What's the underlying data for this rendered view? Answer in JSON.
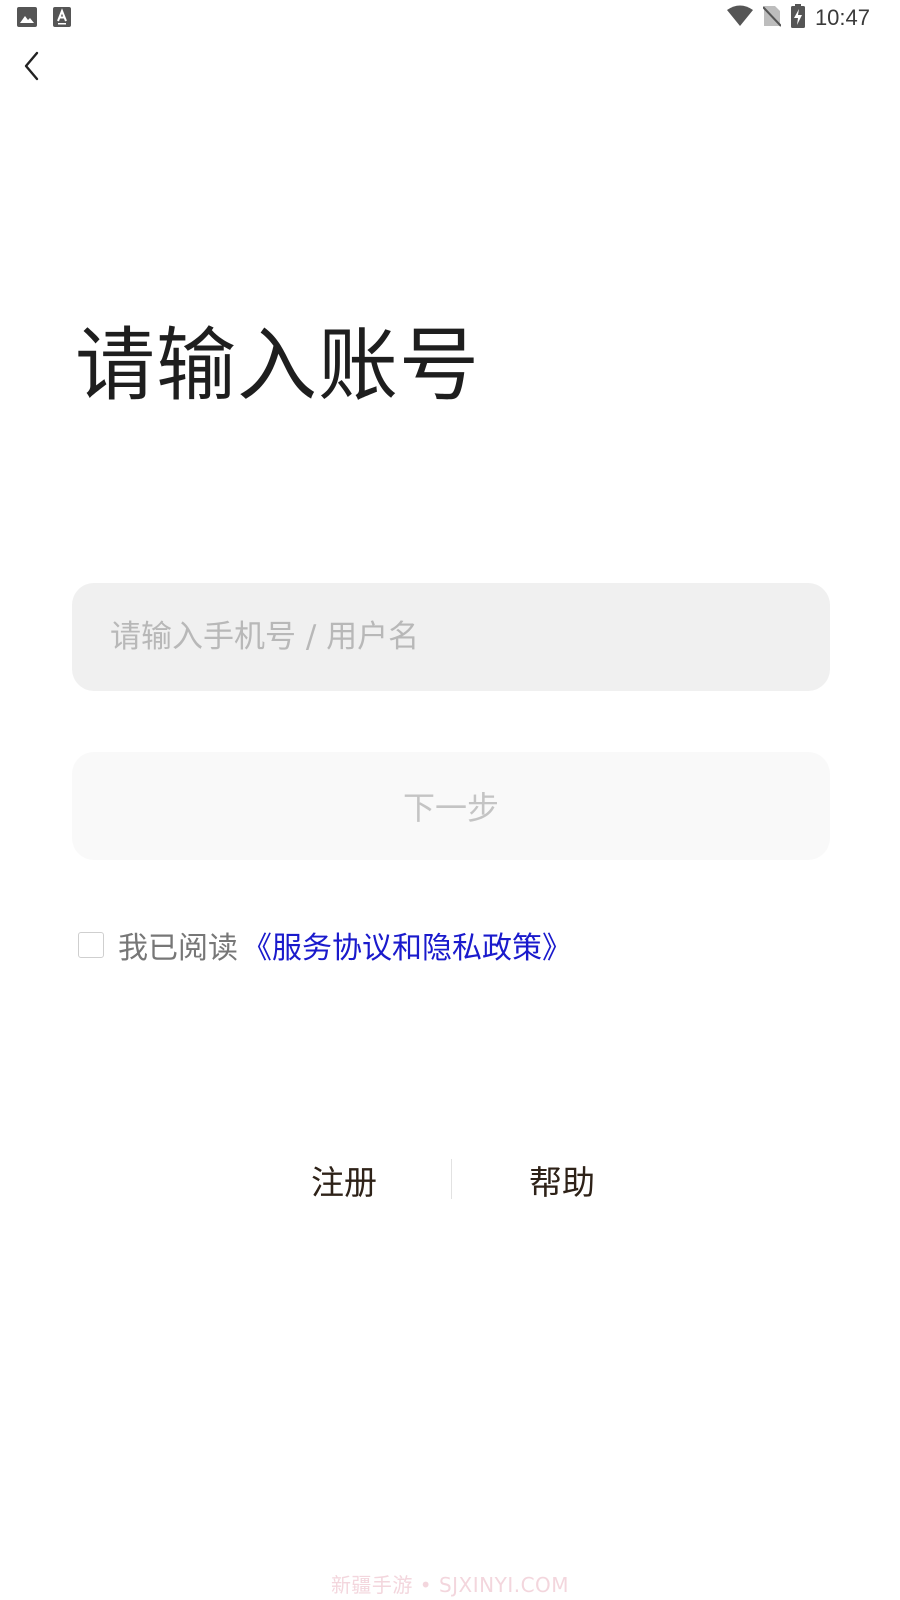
{
  "status_bar": {
    "time": "10:47",
    "left_icons": [
      "image-icon",
      "keyboard-a-icon"
    ],
    "right_icons": [
      "wifi-icon",
      "no-sim-icon",
      "battery-charging-icon"
    ]
  },
  "header": {
    "back_icon": "chevron-left-icon"
  },
  "main": {
    "title": "请输入账号",
    "account_input": {
      "value": "",
      "placeholder": "请输入手机号 / 用户名"
    },
    "next_button_label": "下一步",
    "agreement": {
      "checked": false,
      "prefix": "我已阅读",
      "link_text": "《服务协议和隐私政策》"
    }
  },
  "footer": {
    "register_label": "注册",
    "help_label": "帮助"
  },
  "watermark": "新疆手游 • SJXINYI.COM",
  "colors": {
    "input_bg": "#f0f0f0",
    "button_bg": "#f9f9f9",
    "link": "#1a1acc",
    "title": "#1e1e1e"
  }
}
